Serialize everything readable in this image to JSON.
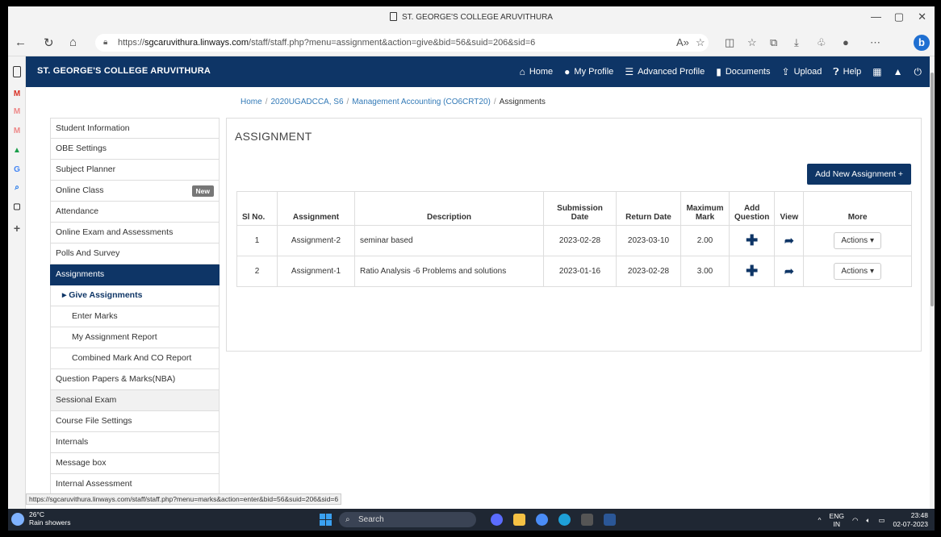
{
  "browser": {
    "window_title": "ST. GEORGE'S COLLEGE ARUVITHURA",
    "url_prefix": "https://",
    "url_domain": "sgcaruvithura.linways.com",
    "url_path": "/staff/staff.php?menu=assignment&action=give&bid=56&suid=206&sid=6",
    "status_url": "https://sgcaruvithura.linways.com/staff/staff.php?menu=marks&action=enter&bid=56&suid=206&sid=6",
    "bing_label": "b"
  },
  "navbar": {
    "brand": "ST. GEORGE'S COLLEGE ARUVITHURA",
    "links": [
      "Home",
      "My Profile",
      "Advanced Profile",
      "Documents",
      "Upload",
      "Help"
    ]
  },
  "breadcrumb": [
    "Home",
    "2020UGADCCA, S6",
    "Management Accounting (CO6CRT20)",
    "Assignments"
  ],
  "sidebar": {
    "items": [
      {
        "label": "Student Information"
      },
      {
        "label": "OBE Settings"
      },
      {
        "label": "Subject Planner"
      },
      {
        "label": "Online Class",
        "badge": "New"
      },
      {
        "label": "Attendance"
      },
      {
        "label": "Online Exam and Assessments"
      },
      {
        "label": "Polls And Survey"
      },
      {
        "label": "Assignments"
      },
      {
        "label": "Give Assignments"
      },
      {
        "label": "Enter Marks"
      },
      {
        "label": "My Assignment Report"
      },
      {
        "label": "Combined Mark And CO Report"
      },
      {
        "label": "Question Papers & Marks(NBA)"
      },
      {
        "label": "Sessional Exam"
      },
      {
        "label": "Course File Settings"
      },
      {
        "label": "Internals"
      },
      {
        "label": "Message box"
      },
      {
        "label": "Internal Assessment"
      }
    ]
  },
  "main": {
    "title": "ASSIGNMENT",
    "add_button": "Add New Assignment +",
    "columns": [
      "Sl No.",
      "Assignment",
      "Description",
      "Submission Date",
      "Return Date",
      "Maximum Mark",
      "Add Question",
      "View",
      "More"
    ],
    "rows": [
      {
        "sl": "1",
        "assignment": "Assignment-2",
        "description": "seminar based",
        "submission": "2023-02-28",
        "return": "2023-03-10",
        "max": "2.00",
        "actions": "Actions"
      },
      {
        "sl": "2",
        "assignment": "Assignment-1",
        "description": "Ratio Analysis -6 Problems and solutions",
        "submission": "2023-01-16",
        "return": "2023-02-28",
        "max": "3.00",
        "actions": "Actions"
      }
    ]
  },
  "taskbar": {
    "temp": "26°C",
    "weather": "Rain showers",
    "search": "Search",
    "lang1": "ENG",
    "lang2": "IN",
    "time": "23:48",
    "date": "02-07-2023"
  }
}
